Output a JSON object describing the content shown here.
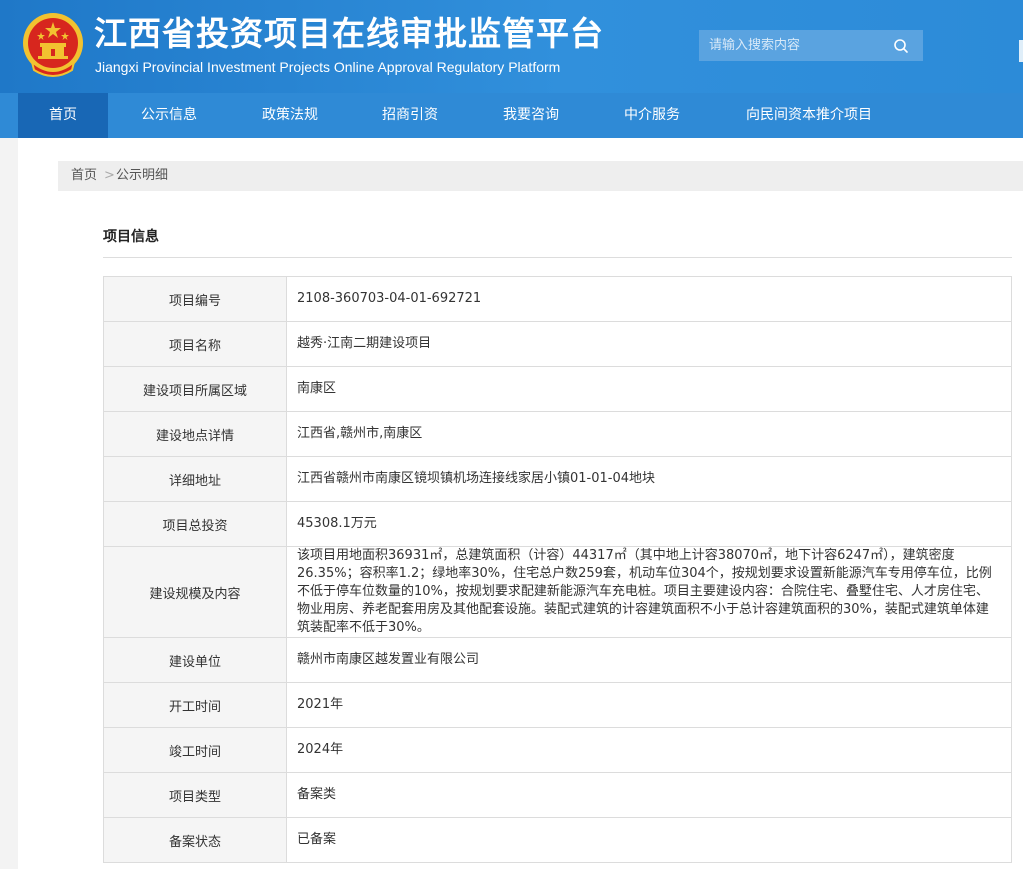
{
  "header": {
    "title": "江西省投资项目在线审批监管平台",
    "subtitle": "Jiangxi Provincial Investment Projects Online Approval Regulatory Platform",
    "search_placeholder": "请输入搜索内容",
    "colors": {
      "header_bg": "#2c8bd8",
      "nav_bg": "#2f8ad6",
      "nav_active": "#1867b5",
      "emblem_red": "#d7261e",
      "emblem_gold": "#f2c230"
    }
  },
  "nav": {
    "items": [
      {
        "label": "首页",
        "active": true
      },
      {
        "label": "公示信息",
        "active": false
      },
      {
        "label": "政策法规",
        "active": false
      },
      {
        "label": "招商引资",
        "active": false
      },
      {
        "label": "我要咨询",
        "active": false
      },
      {
        "label": "中介服务",
        "active": false
      },
      {
        "label": "向民间资本推介项目",
        "active": false
      }
    ]
  },
  "breadcrumb": {
    "home": "首页",
    "separator": ">",
    "current": "公示明细"
  },
  "section": {
    "title": "项目信息"
  },
  "project": {
    "rows": [
      {
        "label": "项目编号",
        "value": "2108-360703-04-01-692721"
      },
      {
        "label": "项目名称",
        "value": "越秀·江南二期建设项目"
      },
      {
        "label": "建设项目所属区域",
        "value": "南康区"
      },
      {
        "label": "建设地点详情",
        "value": "江西省,赣州市,南康区"
      },
      {
        "label": "详细地址",
        "value": "江西省赣州市南康区镜坝镇机场连接线家居小镇01-01-04地块"
      },
      {
        "label": "项目总投资",
        "value": "45308.1万元"
      },
      {
        "label": "建设规模及内容",
        "value": "该项目用地面积36931㎡，总建筑面积（计容）44317㎡（其中地上计容38070㎡，地下计容6247㎡），建筑密度26.35%；容积率1.2；绿地率30%，住宅总户数259套，机动车位304个，按规划要求设置新能源汽车专用停车位，比例不低于停车位数量的10%，按规划要求配建新能源汽车充电桩。项目主要建设内容：合院住宅、叠墅住宅、人才房住宅、物业用房、养老配套用房及其他配套设施。装配式建筑的计容建筑面积不小于总计容建筑面积的30%，装配式建筑单体建筑装配率不低于30%。"
      },
      {
        "label": "建设单位",
        "value": "赣州市南康区越发置业有限公司"
      },
      {
        "label": "开工时间",
        "value": "2021年"
      },
      {
        "label": "竣工时间",
        "value": "2024年"
      },
      {
        "label": "项目类型",
        "value": "备案类"
      },
      {
        "label": "备案状态",
        "value": "已备案"
      }
    ]
  }
}
